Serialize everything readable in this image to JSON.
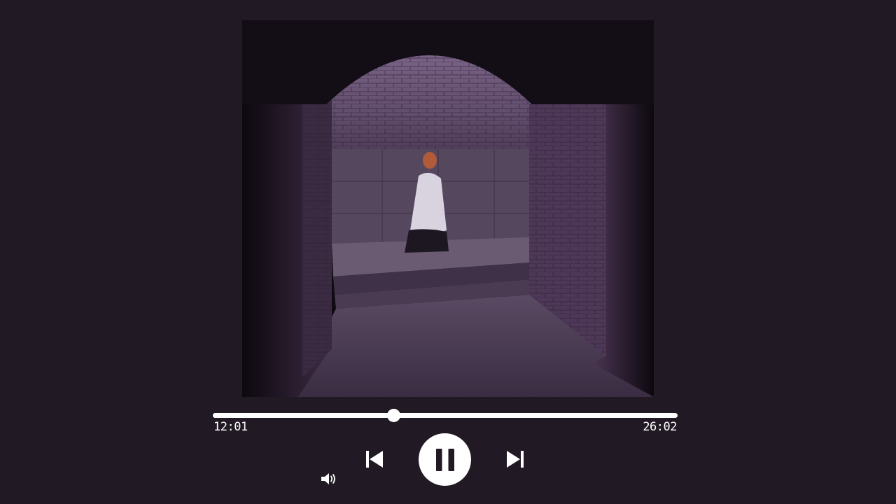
{
  "artwork": {
    "icon": "album-artwork"
  },
  "playback": {
    "elapsed": "12:01",
    "total": "26:02",
    "progress_fraction": 0.389,
    "state": "playing"
  },
  "controls": {
    "previous_icon": "skip-previous-icon",
    "pause_icon": "pause-icon",
    "next_icon": "skip-next-icon",
    "volume_icon": "volume-icon"
  },
  "colors": {
    "background": "#211a24",
    "foreground": "#ffffff",
    "button_icon": "#211a24"
  }
}
